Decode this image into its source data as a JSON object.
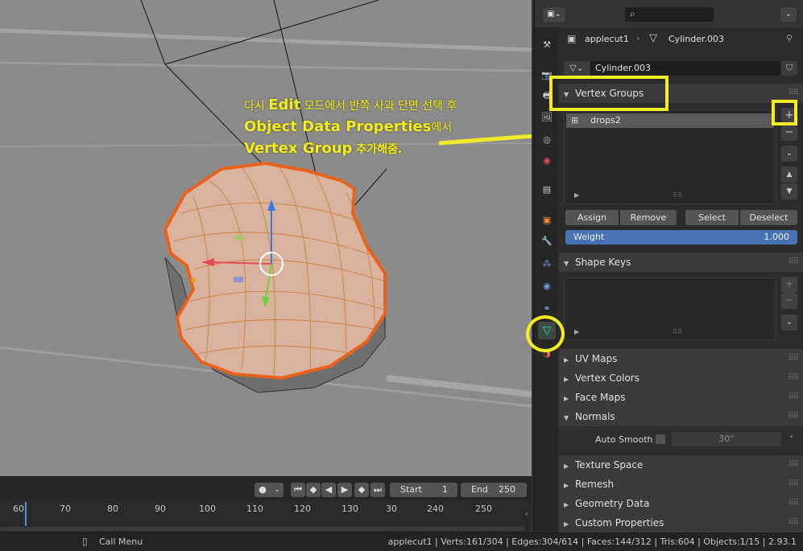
{
  "annotation": {
    "line1_prefix": "다시 ",
    "line1_bold": "Edit",
    "line1_suffix": " 모드에서 반쪽 사과 단면 선택 후",
    "line2_bold": "Object Data Properties",
    "line2_suffix": "에서",
    "line3_bold": "Vertex Group",
    "line3_suffix": " 추가해줌."
  },
  "header": {
    "breadcrumb_object": "applecut1",
    "breadcrumb_mesh": "Cylinder.003",
    "mesh_name_value": "Cylinder.003"
  },
  "vertex_groups": {
    "title": "Vertex Groups",
    "items": [
      {
        "name": "drops2"
      }
    ],
    "assign_label": "Assign",
    "remove_label": "Remove",
    "select_label": "Select",
    "deselect_label": "Deselect",
    "weight_label": "Weight",
    "weight_value": "1.000"
  },
  "shape_keys": {
    "title": "Shape Keys"
  },
  "collapsed_panels": {
    "uv_maps": "UV Maps",
    "vertex_colors": "Vertex Colors",
    "face_maps": "Face Maps"
  },
  "normals": {
    "title": "Normals",
    "auto_smooth_label": "Auto Smooth",
    "angle_value": "30°"
  },
  "lower_panels": {
    "texture_space": "Texture Space",
    "remesh": "Remesh",
    "geometry_data": "Geometry Data",
    "custom_properties": "Custom Properties"
  },
  "timeline": {
    "start_label": "Start",
    "start_value": "1",
    "end_label": "End",
    "end_value": "250",
    "ruler_ticks": [
      "60",
      "70",
      "80",
      "90",
      "100",
      "110",
      "120",
      "130",
      "30",
      "240",
      "250"
    ]
  },
  "statusbar": {
    "call_menu": "Call Menu",
    "stats": "applecut1 | Verts:161/304 | Edges:304/614 | Faces:144/312 | Tris:604 | Objects:1/15 | 2.93.1"
  },
  "colors": {
    "annotation_yellow": "#f2ec28",
    "selection_orange": "#e8621c",
    "weight_blue": "#4772b3",
    "active_tab_green": "#2fd3a0"
  }
}
